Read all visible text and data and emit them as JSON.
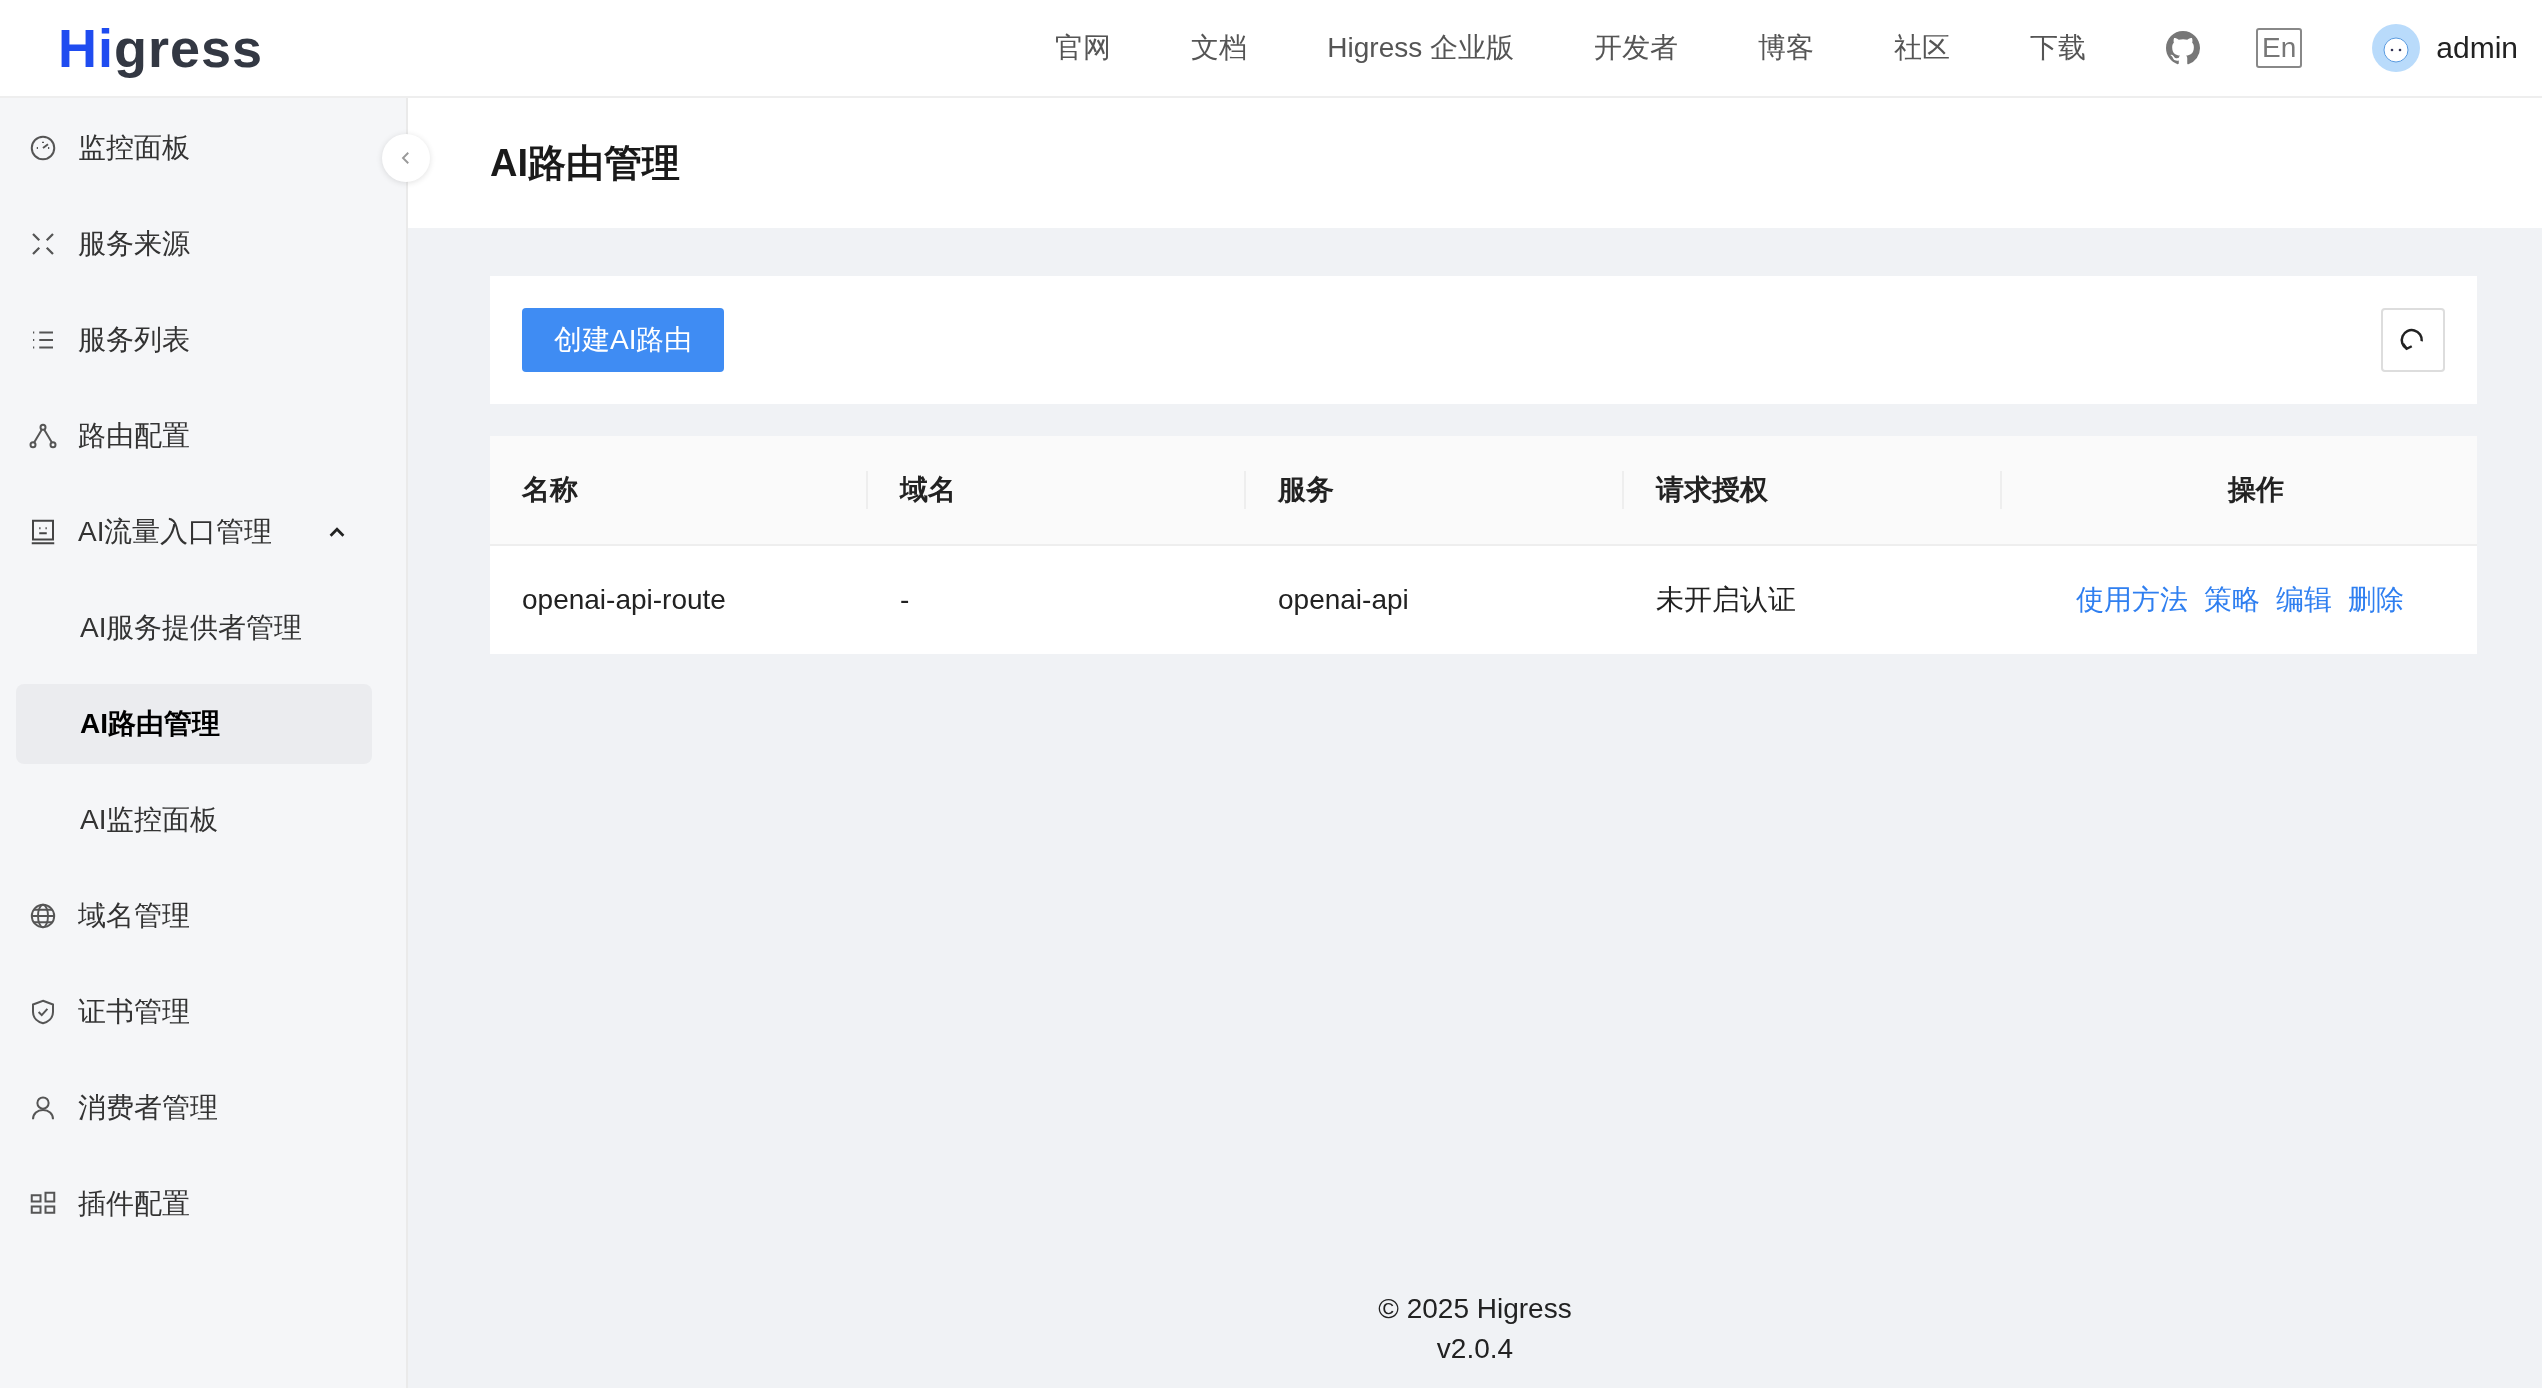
{
  "header": {
    "logo": "Higress",
    "nav": [
      "官网",
      "文档",
      "Higress 企业版",
      "开发者",
      "博客",
      "社区",
      "下载"
    ],
    "language": "En",
    "user": "admin"
  },
  "sidebar": {
    "items": [
      {
        "label": "监控面板",
        "selected": false
      },
      {
        "label": "服务来源",
        "selected": false
      },
      {
        "label": "服务列表",
        "selected": false
      },
      {
        "label": "路由配置",
        "selected": false
      },
      {
        "label": "AI流量入口管理",
        "selected": false,
        "expanded": true,
        "children": [
          {
            "label": "AI服务提供者管理",
            "selected": false
          },
          {
            "label": "AI路由管理",
            "selected": true
          },
          {
            "label": "AI监控面板",
            "selected": false
          }
        ]
      },
      {
        "label": "域名管理",
        "selected": false
      },
      {
        "label": "证书管理",
        "selected": false
      },
      {
        "label": "消费者管理",
        "selected": false
      },
      {
        "label": "插件配置",
        "selected": false
      }
    ]
  },
  "page": {
    "title": "AI路由管理",
    "create_button": "创建AI路由"
  },
  "table": {
    "columns": [
      "名称",
      "域名",
      "服务",
      "请求授权",
      "操作"
    ],
    "rows": [
      {
        "cells": [
          "openai-api-route",
          "-",
          "openai-api",
          "未开启认证"
        ],
        "actions": [
          "使用方法",
          "策略",
          "编辑",
          "删除"
        ]
      }
    ]
  },
  "footer": {
    "copyright": "© 2025 Higress",
    "version": "v2.0.4"
  }
}
